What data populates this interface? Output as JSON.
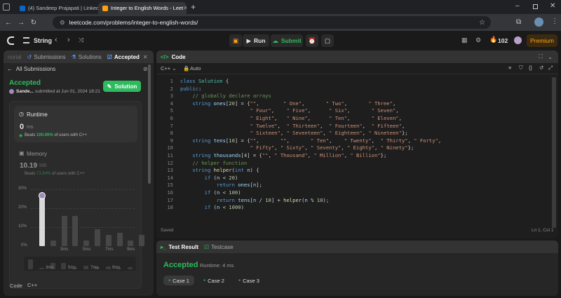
{
  "browser": {
    "tabs": [
      {
        "label": "(4) Sandeep Prajapati | LinkedIn",
        "favicon": "linkedin-icon"
      },
      {
        "label": "Integer to English Words - Leet",
        "favicon": "leetcode-icon"
      }
    ],
    "new_tab": "+",
    "url": "leetcode.com/problems/integer-to-english-words/"
  },
  "header": {
    "problem_list": "String",
    "run": "Run",
    "submit": "Submit",
    "streak": "102",
    "premium": "Premium"
  },
  "left_panel": {
    "tabs": [
      "norial",
      "Submissions",
      "Solutions",
      "Accepted"
    ],
    "back": "All Submissions",
    "status": "Accepted",
    "user": "Sande...",
    "submitted": "submitted at Jun 01, 2024 18:21",
    "solution_btn": "Solution",
    "runtime": {
      "title": "Runtime",
      "value": "0",
      "unit": "ms",
      "beats_prefix": "Beats",
      "beats_pct": "100.00%",
      "beats_suffix": "of users with C++"
    },
    "memory": {
      "title": "Memory",
      "value": "10.19",
      "unit": "MB",
      "beats_prefix": "Beats",
      "beats_pct": "73.84%",
      "beats_suffix": "of users with C++"
    },
    "chart": {
      "y_ticks": [
        "30%",
        "20%",
        "10%",
        "0%"
      ],
      "x_ticks": [
        "3ms",
        "5ms",
        "7ms",
        "9ms"
      ],
      "mini_x_ticks": [
        "3ms",
        "5ms",
        "7ms",
        "9ms"
      ]
    },
    "code_label": "Code",
    "lang": "C++"
  },
  "chart_data": {
    "type": "bar",
    "categories": [
      "0ms",
      "1ms",
      "2ms",
      "3ms",
      "4ms",
      "5ms",
      "6ms",
      "7ms",
      "8ms",
      "9ms"
    ],
    "values": [
      27,
      3,
      16,
      16,
      3,
      9,
      6,
      7,
      3,
      6
    ],
    "ylim": [
      0,
      30
    ],
    "highlight_index": 0
  },
  "editor": {
    "title": "Code",
    "lang": "C++",
    "auto": "Auto",
    "status_left": "Saved",
    "status_right": "Ln 1, Col 1",
    "lines": [
      "class Solution {",
      "public:",
      "    // globally declare arrays",
      "    string ones[20] = {\"\",        \" One\",       \" Two\",       \" Three\",",
      "                       \" Four\",    \" Five\",      \" Six\",       \" Seven\",",
      "                       \" Eight\",   \" Nine\",      \" Ten\",       \" Eleven\",",
      "                       \" Twelve\",  \" Thirteen\",  \" Fourteen\",  \" Fifteen\",",
      "                       \" Sixteen\", \" Seventeen\", \" Eighteen\", \" Nineteen\"};",
      "    string tens[10] = {\"\",       \"\",       \" Ten\",    \" Twenty\",  \" Thirty\", \" Forty\",",
      "                       \" Fifty\", \" Sixty\", \" Seventy\", \" Eighty\", \" Ninety\"};",
      "    string thousands[4] = {\"\", \" Thousand\", \" Million\", \" Billion\"};",
      "    // helper function",
      "    string helper(int n) {",
      "        if (n < 20)",
      "            return ones[n];",
      "        if (n < 100)",
      "            return tens[n / 10] + helper(n % 10);",
      "        if (n < 1000)"
    ]
  },
  "result": {
    "tab1": "Test Result",
    "tab2": "Testcase",
    "status": "Accepted",
    "runtime": "Runtime: 4 ms",
    "cases": [
      "Case 1",
      "Case 2",
      "Case 3"
    ]
  }
}
